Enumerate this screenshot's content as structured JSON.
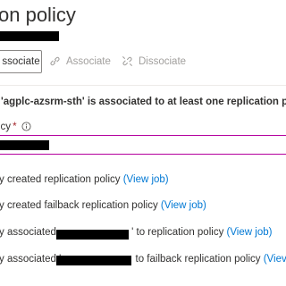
{
  "page": {
    "title": "on policy"
  },
  "toolbar": {
    "associate_label": "ssociate",
    "associate_disabled_label": "Associate",
    "dissociate_label": "Dissociate"
  },
  "info_message": "'agplc-azsrm-sth' is associated to at least one replication po",
  "policy_field": {
    "label": "icy",
    "required_mark": "*"
  },
  "status": [
    {
      "text": "y created replication policy ",
      "link": "(View job)"
    },
    {
      "text": "y created failback replication policy ",
      "link": "(View job)"
    },
    {
      "prefix": "y associated ",
      "suffix": "' to replication policy ",
      "link": "(View job)"
    },
    {
      "prefix": "y associated '",
      "suffix": " to failback replication policy ",
      "link": "(Viev"
    }
  ],
  "colors": {
    "link": "#0078d4",
    "focus_border": "#b4009e",
    "required": "#a4262c",
    "disabled_text": "#a19f9d"
  },
  "icons": [
    "link-icon",
    "info-icon"
  ]
}
